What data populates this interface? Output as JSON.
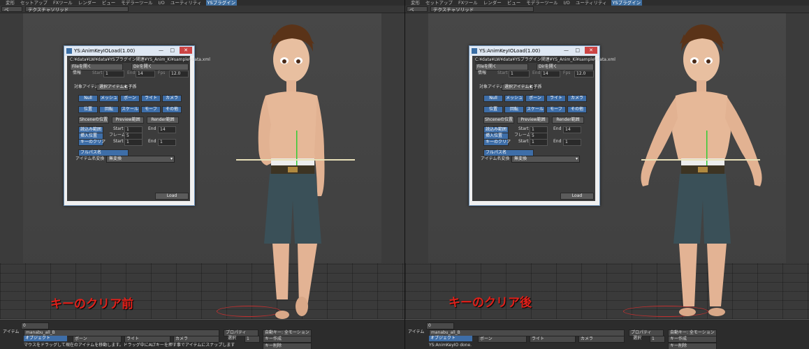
{
  "menu_tabs": [
    "変形",
    "セットアップ",
    "FXツール",
    "レンダー",
    "ビュー",
    "モデラーツール",
    "I/O",
    "ユーティリティ",
    "YSプラグイン"
  ],
  "active_tab": "YSプラグイン",
  "viewport_mode": "テクスチャソリッド",
  "viewport_letter": "ペ",
  "dialog": {
    "title": "YS:AnimKeyIOLoad(1.00)",
    "path": "C:¥data¥LW¥data¥YSプラグイン関連¥YS_Anim_Ki¥sample¥data.xml",
    "file_open": "Fileを開く",
    "dir_open": "Dirを開く",
    "info_label": "情報",
    "start_label": "Start",
    "start_value": "1",
    "end_label": "End",
    "end_value": "14",
    "fps_label": "Fps",
    "fps_value": "12.0",
    "target_label": "対象アイテム",
    "target_value": "選択アイテムと子孫",
    "types_row1": [
      "Null",
      "メッシュ",
      "ボーン",
      "ライト",
      "カメラ"
    ],
    "types_row2": [
      "位置",
      "回転",
      "スケール",
      "モーフ",
      "その他"
    ],
    "range_buttons": [
      "Shceneの位置",
      "Preview範囲",
      "Render範囲"
    ],
    "read_range": "読込み範囲",
    "insert_pos": "挿入位置",
    "key_clear": "キーのクリア",
    "read_start_label": "Start",
    "read_start_value": "1",
    "read_end_label": "End",
    "read_end_value": "14",
    "frames_label": "フレーム数",
    "frames_value": "5",
    "clear_start_label": "Start",
    "clear_start_value": "1",
    "clear_end_label": "End",
    "clear_end_value": "1",
    "fullpath": "フルパス名",
    "name_conv_label": "アイテム名変換",
    "name_conv_value": "無変換",
    "load": "Load"
  },
  "captions": {
    "left": "キーのクリア前",
    "right": "キーのクリア後"
  },
  "bottom": {
    "item_label": "アイテム",
    "item_value": "manabu_all_B",
    "objects": "オブジェクト",
    "bones": "ボーン",
    "lights": "ライト",
    "cameras": "カメラ",
    "property": "プロパティ",
    "auto_key": "自動キー: 全モーション",
    "select": "選択",
    "select_value": "1",
    "create_key": "キー作成",
    "delete_key": "キー削除",
    "status_left": "マウスをドラッグして現在のアイテムを移動します。ドラッグ中にALTキーを押す事でアイテムにスナップします",
    "status_right": "YS:AnimKeyIO done.",
    "timeline_start": "0"
  }
}
